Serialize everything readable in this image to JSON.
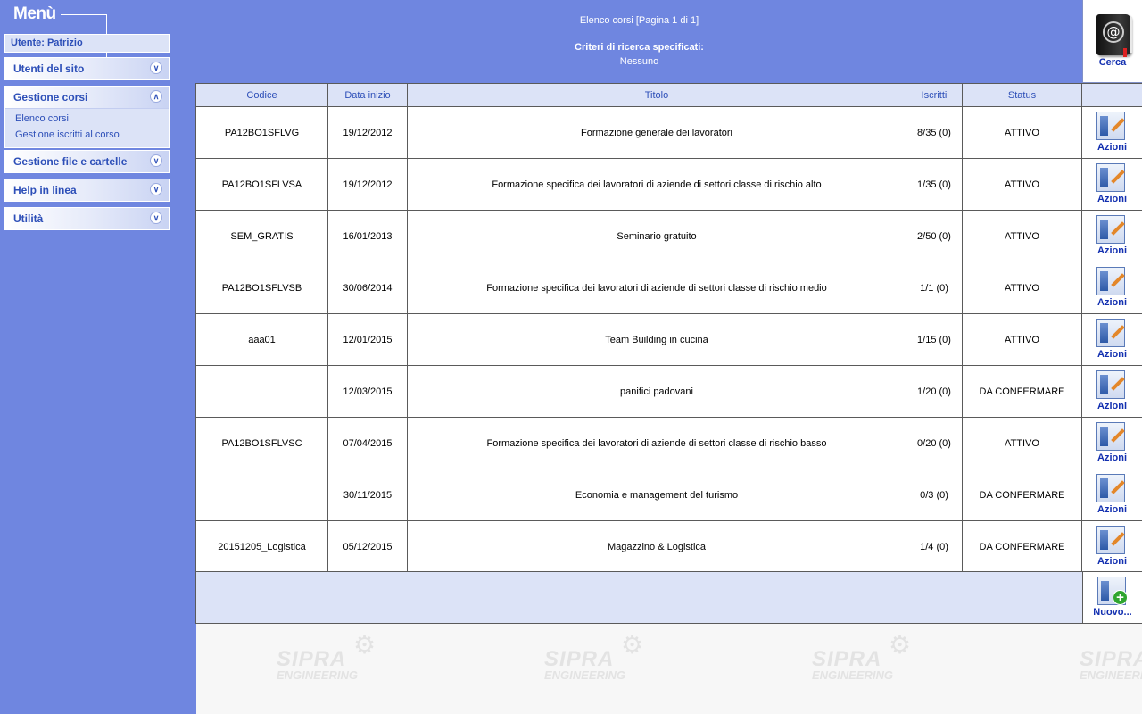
{
  "sidebar": {
    "menu_title": "Menù",
    "user_label": "Utente: Patrizio",
    "panels": [
      {
        "label": "Utenti del sito",
        "state": "collapsed",
        "icon": "chevron-double-down-icon",
        "links": []
      },
      {
        "label": "Gestione corsi",
        "state": "expanded",
        "icon": "chevron-double-up-icon",
        "links": [
          "Elenco corsi",
          "Gestione iscritti al corso"
        ]
      },
      {
        "label": "Gestione file e cartelle",
        "state": "collapsed",
        "icon": "chevron-double-down-icon",
        "links": []
      },
      {
        "label": "Help in linea",
        "state": "collapsed",
        "icon": "chevron-double-down-icon",
        "links": []
      },
      {
        "label": "Utilità",
        "state": "collapsed",
        "icon": "chevron-double-down-icon",
        "links": []
      }
    ]
  },
  "header": {
    "page_info": "Elenco corsi [Pagina 1 di 1]",
    "criteria_label": "Criteri di ricerca specificati:",
    "criteria_value": "Nessuno"
  },
  "search_button": {
    "label": "Cerca",
    "icon": "address-book-icon"
  },
  "table": {
    "columns": [
      "Codice",
      "Data inizio",
      "Titolo",
      "Iscritti",
      "Status",
      ""
    ],
    "action_label": "Azioni",
    "action_icon": "edit-document-icon",
    "rows": [
      {
        "code": "PA12BO1SFLVG",
        "date": "19/12/2012",
        "title": "Formazione generale dei lavoratori",
        "enrolled": "8/35 (0)",
        "status": "ATTIVO"
      },
      {
        "code": "PA12BO1SFLVSA",
        "date": "19/12/2012",
        "title": "Formazione specifica dei lavoratori di aziende di settori classe di rischio alto",
        "enrolled": "1/35 (0)",
        "status": "ATTIVO"
      },
      {
        "code": "SEM_GRATIS",
        "date": "16/01/2013",
        "title": "Seminario gratuito",
        "enrolled": "2/50 (0)",
        "status": "ATTIVO"
      },
      {
        "code": "PA12BO1SFLVSB",
        "date": "30/06/2014",
        "title": "Formazione specifica dei lavoratori di aziende di settori classe di rischio medio",
        "enrolled": "1/1 (0)",
        "status": "ATTIVO"
      },
      {
        "code": "aaa01",
        "date": "12/01/2015",
        "title": "Team Building in cucina",
        "enrolled": "1/15 (0)",
        "status": "ATTIVO"
      },
      {
        "code": "",
        "date": "12/03/2015",
        "title": "panifici padovani",
        "enrolled": "1/20 (0)",
        "status": "DA CONFERMARE"
      },
      {
        "code": "PA12BO1SFLVSC",
        "date": "07/04/2015",
        "title": "Formazione specifica dei lavoratori di aziende di settori classe di rischio basso",
        "enrolled": "0/20 (0)",
        "status": "ATTIVO"
      },
      {
        "code": "",
        "date": "30/11/2015",
        "title": "Economia e management del turismo",
        "enrolled": "0/3 (0)",
        "status": "DA CONFERMARE"
      },
      {
        "code": "20151205_Logistica",
        "date": "05/12/2015",
        "title": "Magazzino & Logistica",
        "enrolled": "1/4 (0)",
        "status": "DA CONFERMARE"
      }
    ]
  },
  "new_button": {
    "label": "Nuovo...",
    "icon": "new-document-icon"
  },
  "watermark": {
    "line1": "SIPRA",
    "line2": "ENGINEERING",
    "icon": "gear-icon",
    "repeat": 4
  },
  "colors": {
    "background": "#6f86e0",
    "panel": "#dce3f7",
    "link": "#2d4fb8",
    "action_label": "#1330b0"
  }
}
